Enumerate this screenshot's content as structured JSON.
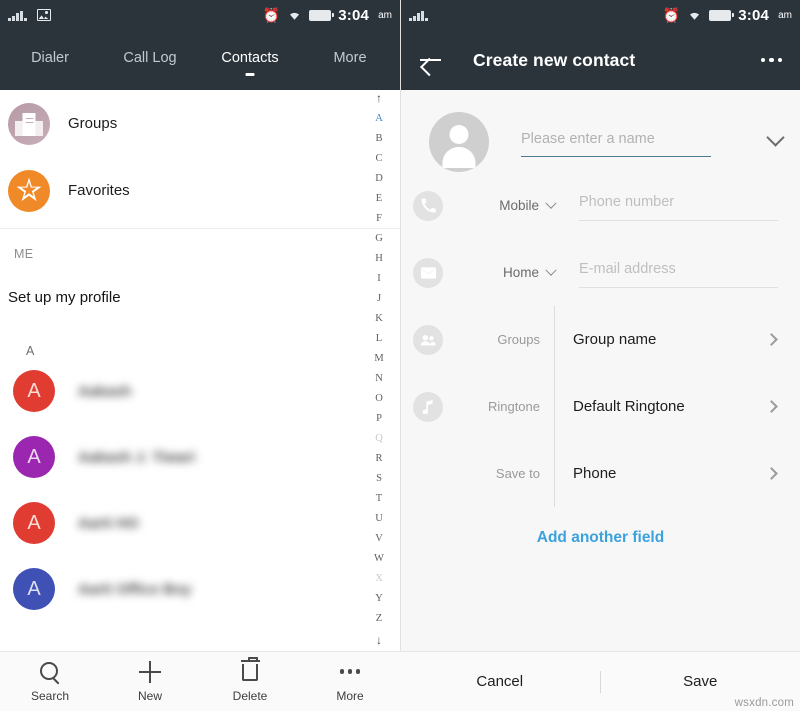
{
  "status_bar": {
    "signal_icon": "signal-bars-icon",
    "photo_icon": "photo-notification-icon",
    "alarm_icon": "alarm-clock-icon",
    "wifi_icon": "wifi-icon",
    "battery_icon": "battery-full-icon",
    "time": "3:04",
    "ampm": "am"
  },
  "left_panel": {
    "tabs": [
      {
        "label": "Dialer",
        "active": false
      },
      {
        "label": "Call Log",
        "active": false
      },
      {
        "label": "Contacts",
        "active": true
      },
      {
        "label": "More",
        "active": false
      }
    ],
    "quick_rows": [
      {
        "label": "Groups",
        "icon": "groups-building-icon"
      },
      {
        "label": "Favorites",
        "icon": "star-icon"
      }
    ],
    "me_section_header": "ME",
    "me_row_label": "Set up my profile",
    "alpha_section_header": "A",
    "contacts": [
      {
        "initial": "A",
        "name": "Aakash",
        "color": "#e03c31"
      },
      {
        "initial": "A",
        "name": "Aakash J. Tiwari",
        "color": "#9b27b0"
      },
      {
        "initial": "A",
        "name": "Aarti HO",
        "color": "#e03c31"
      },
      {
        "initial": "A",
        "name": "Aarti Office Boy",
        "color": "#3f51b5"
      }
    ],
    "alpha_index": {
      "top_arrow": "↑",
      "bottom_arrow": "↓",
      "letters": [
        "A",
        "B",
        "C",
        "D",
        "E",
        "F",
        "G",
        "H",
        "I",
        "J",
        "K",
        "L",
        "M",
        "N",
        "O",
        "P",
        "Q",
        "R",
        "S",
        "T",
        "U",
        "V",
        "W",
        "X",
        "Y",
        "Z"
      ],
      "selected": "A",
      "disabled": [
        "Q",
        "X"
      ],
      "selected_color": "#3a86c8"
    },
    "bottom_bar": [
      {
        "label": "Search",
        "icon": "search-icon"
      },
      {
        "label": "New",
        "icon": "plus-icon"
      },
      {
        "label": "Delete",
        "icon": "trash-icon"
      },
      {
        "label": "More",
        "icon": "more-dots-icon"
      }
    ]
  },
  "right_panel": {
    "back_icon": "back-arrow-icon",
    "title": "Create new contact",
    "overflow_icon": "more-dots-icon",
    "avatar_icon": "person-placeholder-icon",
    "name_field": {
      "value": "",
      "placeholder": "Please enter a name",
      "expand_icon": "chevron-down-icon",
      "underline_color": "#4b7c8f"
    },
    "fields": [
      {
        "icon": "phone-icon",
        "type_label": "Mobile",
        "type_chevron": "chevron-down-icon",
        "value": "",
        "placeholder": "Phone number"
      },
      {
        "icon": "email-icon",
        "type_label": "Home",
        "type_chevron": "chevron-down-icon",
        "value": "",
        "placeholder": "E-mail address"
      }
    ],
    "selects": [
      {
        "icon": "people-icon",
        "label": "Groups",
        "value": "Group name",
        "chevron": "chevron-right-icon"
      },
      {
        "icon": "music-note-icon",
        "label": "Ringtone",
        "value": "Default Ringtone",
        "chevron": "chevron-right-icon"
      },
      {
        "icon": null,
        "label": "Save to",
        "value": "Phone",
        "chevron": "chevron-right-icon"
      }
    ],
    "add_another_field": "Add another field",
    "add_field_color": "#3ba2dd",
    "footer": {
      "cancel_label": "Cancel",
      "save_label": "Save"
    }
  },
  "watermark": "wsxdn.com",
  "theme": {
    "header_bg": "#2b343b",
    "left_bg": "#ffffff",
    "right_bg": "#f7f7f7",
    "accent": "#3ba2dd"
  }
}
